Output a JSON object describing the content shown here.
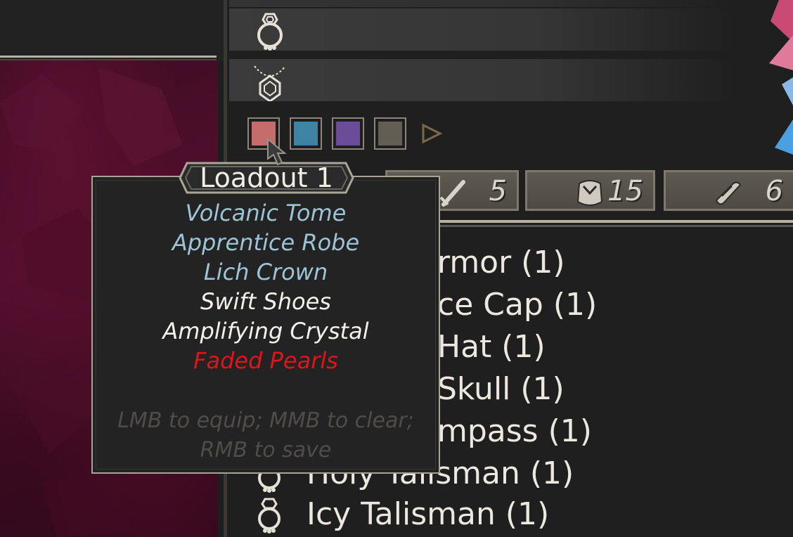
{
  "colors": {
    "accent_blue_text": "#9cc3d6",
    "white_text": "#f4f1ea",
    "red_text": "#e2141b",
    "hint_text": "#4f4d48",
    "panel_bg": "#1f1f1f",
    "frame": "#b9b2a3"
  },
  "equipment_slots": [
    {
      "icon": "ring-icon"
    },
    {
      "icon": "necklace-icon"
    }
  ],
  "loadouts": {
    "squares": [
      {
        "color": "#c76c6c",
        "icon": "loadout-1-swatch"
      },
      {
        "color": "#3f83a3",
        "icon": "loadout-2-swatch"
      },
      {
        "color": "#6a4c98",
        "icon": "loadout-3-swatch"
      },
      {
        "color": "#625d55",
        "icon": "loadout-4-swatch"
      }
    ],
    "next_icon": "play-arrow-icon"
  },
  "stats": [
    {
      "icon": "sword-icon",
      "value": "5"
    },
    {
      "icon": "armor-icon",
      "value": "15"
    },
    {
      "icon": "scroll-icon",
      "value": "6"
    }
  ],
  "item_list": [
    {
      "text": "rmor (1)"
    },
    {
      "text": "ce Cap (1)"
    },
    {
      "text": "Hat (1)"
    },
    {
      "text": "Skull (1)"
    },
    {
      "text": "mpass (1)"
    },
    {
      "text": "Holy Talisman (1)"
    },
    {
      "text": "Icy Talisman (1)"
    }
  ],
  "tooltip": {
    "title": "Loadout 1",
    "items": [
      {
        "name": "Volcanic Tome",
        "color": "#9cc3d6"
      },
      {
        "name": "Apprentice Robe",
        "color": "#9cc3d6"
      },
      {
        "name": "Lich Crown",
        "color": "#9cc3d6"
      },
      {
        "name": "Swift Shoes",
        "color": "#f4f1ea"
      },
      {
        "name": "Amplifying Crystal",
        "color": "#f4f1ea"
      },
      {
        "name": "Faded Pearls",
        "color": "#e2141b"
      }
    ],
    "hint_line1": "LMB to equip; MMB to clear;",
    "hint_line2": "RMB to save"
  }
}
